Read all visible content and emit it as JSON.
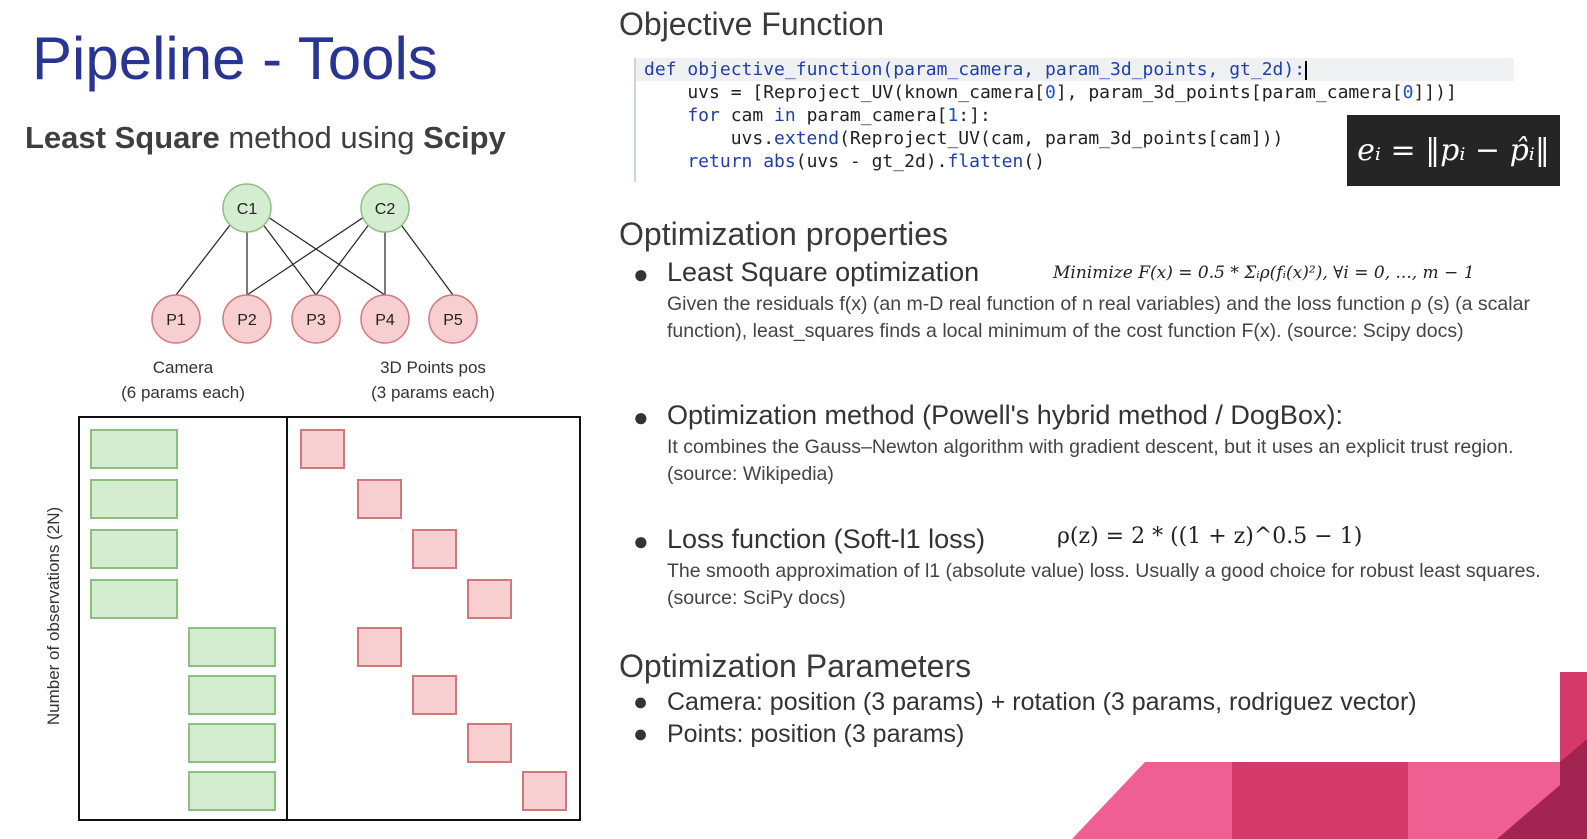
{
  "slide": {
    "title": "Pipeline - Tools",
    "subtitle": {
      "part1": "Least Square",
      "part2": " method using ",
      "part3": "Scipy"
    }
  },
  "diagram": {
    "camera_nodes": [
      "C1",
      "C2"
    ],
    "point_nodes": [
      "P1",
      "P2",
      "P3",
      "P4",
      "P5"
    ],
    "camera_label": "Camera",
    "camera_sublabel": "(6 params each)",
    "points_label": "3D Points pos",
    "points_sublabel": "(3 params each)",
    "y_axis_label": "Number of observations (2N)"
  },
  "objective": {
    "heading": "Objective Function",
    "code": {
      "line1_kw": "def ",
      "line1_name": "objective_function(param_camera, param_3d_points, gt_2d):",
      "line2_a": "    uvs = [Reproject_UV(known_camera[",
      "line2_num1": "0",
      "line2_b": "], param_3d_points[param_camera[",
      "line2_num2": "0",
      "line2_c": "]])]",
      "line3_kw1": "    for",
      "line3_a": " cam ",
      "line3_kw2": "in",
      "line3_b": " param_camera[",
      "line3_num": "1",
      "line3_c": ":]:",
      "line4_a": "        uvs.",
      "line4_kw": "extend",
      "line4_b": "(Reproject_UV(cam, param_3d_points[cam]))",
      "line5_kw1": "    return",
      "line5_a": " ",
      "line5_kw2": "abs",
      "line5_b": "(uvs - gt_2d).",
      "line5_kw3": "flatten",
      "line5_c": "()"
    },
    "equation": "eᵢ = ‖pᵢ − p̂ᵢ‖"
  },
  "properties": {
    "heading": "Optimization properties",
    "items": [
      {
        "title": "Least Square optimization",
        "formula": "Minimize F(x) = 0.5 * Σᵢρ(fᵢ(x)²), ∀i = 0, ..., m − 1",
        "desc": "Given the residuals f(x) (an m-D real function of n real variables) and the loss function ρ (s) (a scalar function), least_squares finds a local minimum of the cost function F(x). (source: Scipy docs)"
      },
      {
        "title": "Optimization method (Powell's hybrid method / DogBox):",
        "desc": "It combines the Gauss–Newton algorithm with gradient descent, but it uses an explicit trust region. (source: Wikipedia)"
      },
      {
        "title": "Loss function (Soft-l1 loss)",
        "formula": "ρ(z) = 2 * ((1 + z)^0.5 − 1)",
        "desc": "The smooth approximation of l1 (absolute value) loss. Usually a good choice for robust least squares. (source: SciPy docs)"
      }
    ]
  },
  "parameters": {
    "heading": "Optimization Parameters",
    "items": [
      "Camera: position (3 params) + rotation (3 params, rodriguez vector)",
      "Points: position (3 params)"
    ]
  },
  "colors": {
    "title": "#283593",
    "camera_fill": "#d4ecd0",
    "camera_stroke": "#8dc07e",
    "point_fill": "#f8cfd1",
    "point_stroke": "#d1787d",
    "deco_light": "#ef5f91",
    "deco_dark": "#d63a6a",
    "deco_darkest": "#a32450"
  }
}
